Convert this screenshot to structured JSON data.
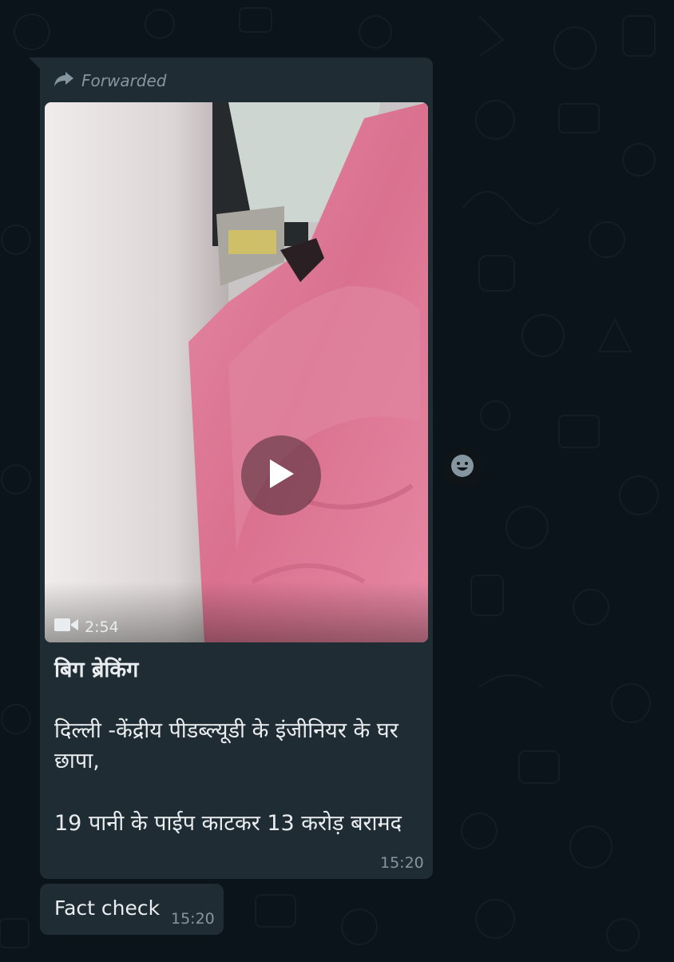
{
  "message": {
    "forwarded_label": "Forwarded",
    "video": {
      "duration": "2:54",
      "icons": [
        "forward-arrow-icon",
        "play-icon",
        "video-camera-icon"
      ]
    },
    "caption": {
      "title": "बिग ब्रेकिंग",
      "line2": "दिल्ली -केंद्रीय पीडब्ल्यूडी के इंजीनियर के घर छापा,",
      "line3": "19 पानी के पाईप काटकर 13 करोड़ बरामद"
    },
    "time": "15:20"
  },
  "reply": {
    "text": "Fact check",
    "time": "15:20"
  },
  "reaction": {
    "icon": "emoji-smile-icon"
  },
  "colors": {
    "background": "#0b141a",
    "bubble": "#1f2c34",
    "text": "#e9edef",
    "meta": "#8696a0"
  }
}
